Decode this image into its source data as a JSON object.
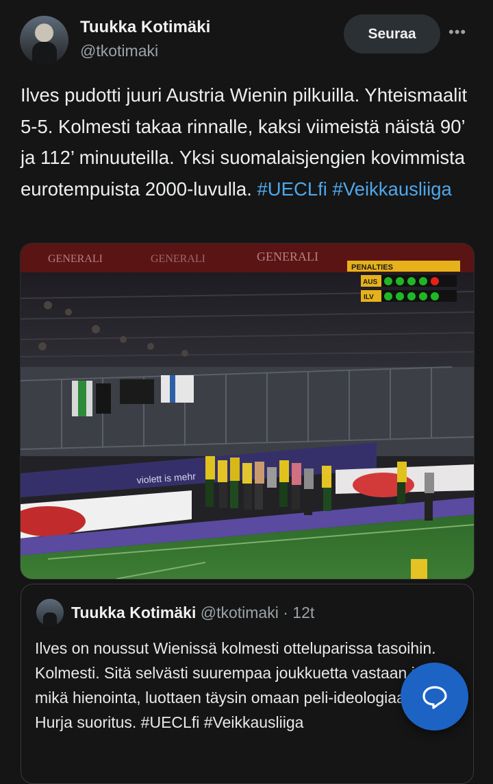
{
  "author": {
    "name": "Tuukka Kotimäki",
    "handle": "@tkotimaki",
    "follow_label": "Seuraa",
    "more_icon": "more-horizontal-icon"
  },
  "tweet": {
    "text": "Ilves pudotti juuri Austria Wienin pilkuilla. Yhteismaalit 5-5. Kolmesti takaa rinnalle, kaksi viimeistä näistä 90’ ja 112’ minuuteilla. Yksi suomalaisjengien kovimmista eurotempuista 2000-luvulla.",
    "hashtags": [
      "#UECLfi",
      "#Veikkausliiga"
    ]
  },
  "media": {
    "sponsor": "GENERALI",
    "banner": "violett is mehr",
    "scoreboard": {
      "title": "PENALTIES",
      "teams": [
        {
          "code": "AUS",
          "results": [
            "scored",
            "scored",
            "scored",
            "scored",
            "missed"
          ]
        },
        {
          "code": "ILV",
          "results": [
            "scored",
            "scored",
            "scored",
            "scored",
            "scored"
          ]
        }
      ]
    }
  },
  "quote": {
    "name": "Tuukka Kotimäki",
    "handle": "@tkotimaki",
    "time": "12t",
    "text": "Ilves on noussut Wienissä kolmesti otteluparissa tasoihin. Kolmesti. Sitä selvästi suurempaa joukkuetta vastaan ja mikä hienointa, luottaen täysin omaan peli-ideologiaansa. Hurja suoritus.",
    "hashtags": "#UECLfi #Veikkausliiga"
  },
  "fab": {
    "icon": "speech-bubble-icon"
  },
  "colors": {
    "background": "#151515",
    "link": "#4ea7eb",
    "fab": "#1d63c4",
    "scored": "#1fb824",
    "missed": "#e42218"
  }
}
